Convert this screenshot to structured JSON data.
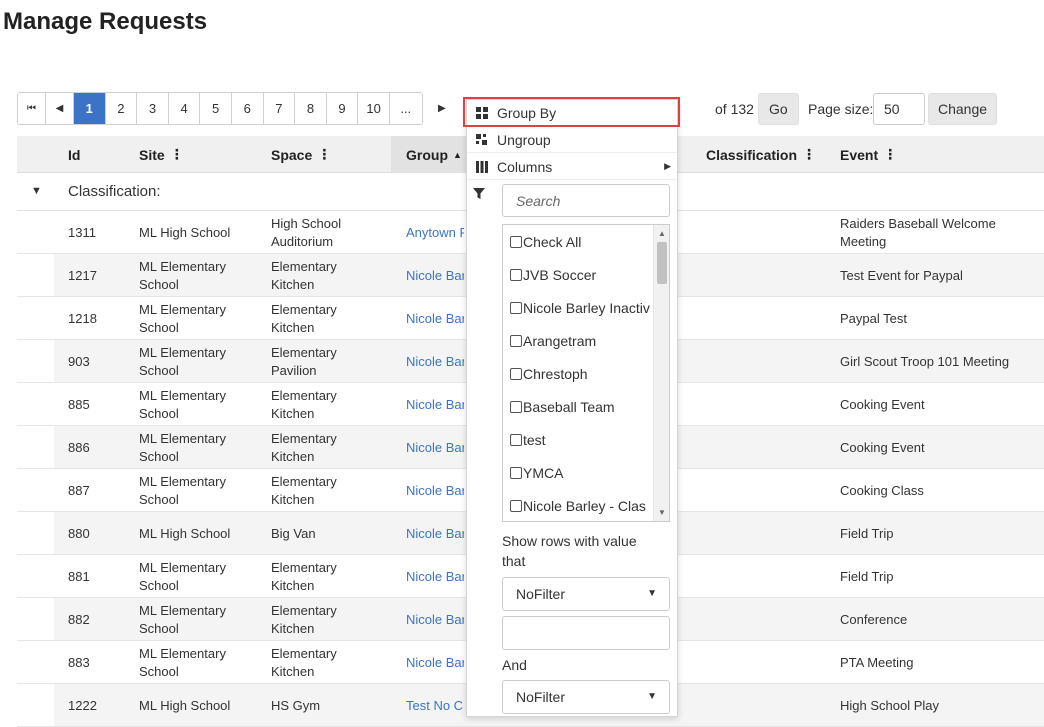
{
  "page": {
    "title": "Manage Requests"
  },
  "pager": {
    "first_icon": "first-page-icon",
    "prev_icon": "prev-page-icon",
    "next_icon": "next-page-icon",
    "pages": [
      "1",
      "2",
      "3",
      "4",
      "5",
      "6",
      "7",
      "8",
      "9",
      "10",
      "..."
    ],
    "active_page": "1",
    "current_page_partial": "1",
    "of_label": "of 132",
    "go_label": "Go",
    "page_size_label": "Page size:",
    "page_size_value": "50",
    "change_label": "Change"
  },
  "grid": {
    "columns": [
      "Id",
      "Site",
      "Space",
      "Group",
      "Classification",
      "Event"
    ],
    "group_label": "Classification:",
    "rows": [
      {
        "id": "1311",
        "site": "ML High School",
        "space": "High School Auditorium",
        "group": "Anytown F Baseball",
        "event": "Raiders Baseball Welcome Meeting"
      },
      {
        "id": "1217",
        "site": "ML Elementary School",
        "space": "Elementary Kitchen",
        "group": "Nicole Bar",
        "event": "Test Event for Paypal"
      },
      {
        "id": "1218",
        "site": "ML Elementary School",
        "space": "Elementary Kitchen",
        "group": "Nicole Bar",
        "event": "Paypal Test"
      },
      {
        "id": "903",
        "site": "ML Elementary School",
        "space": "Elementary Pavilion",
        "group": "Nicole Bar",
        "event": "Girl Scout Troop 101 Meeting"
      },
      {
        "id": "885",
        "site": "ML Elementary School",
        "space": "Elementary Kitchen",
        "group": "Nicole Bar",
        "event": "Cooking Event"
      },
      {
        "id": "886",
        "site": "ML Elementary School",
        "space": "Elementary Kitchen",
        "group": "Nicole Bar",
        "event": "Cooking Event"
      },
      {
        "id": "887",
        "site": "ML Elementary School",
        "space": "Elementary Kitchen",
        "group": "Nicole Bar",
        "event": "Cooking Class"
      },
      {
        "id": "880",
        "site": "ML High School",
        "space": "Big Van",
        "group": "Nicole Bar",
        "event": "Field Trip"
      },
      {
        "id": "881",
        "site": "ML Elementary School",
        "space": "Elementary Kitchen",
        "group": "Nicole Bar",
        "event": "Field Trip"
      },
      {
        "id": "882",
        "site": "ML Elementary School",
        "space": "Elementary Kitchen",
        "group": "Nicole Bar",
        "event": "Conference"
      },
      {
        "id": "883",
        "site": "ML Elementary School",
        "space": "Elementary Kitchen",
        "group": "Nicole Bar",
        "event": "PTA Meeting"
      },
      {
        "id": "1222",
        "site": "ML High School",
        "space": "HS Gym",
        "group": "Test No C",
        "event": "High School Play"
      }
    ]
  },
  "menu": {
    "group_by": "Group By",
    "ungroup": "Ungroup",
    "columns": "Columns",
    "search_placeholder": "Search",
    "filter_items": [
      "Check All",
      "JVB Soccer",
      "Nicole Barley Inactiv",
      "Arangetram",
      "Chrestoph",
      "Baseball Team",
      "test",
      "YMCA",
      "Nicole Barley - Clas"
    ],
    "show_rows_label": "Show rows with value that",
    "filter1_value": "NoFilter",
    "and_label": "And",
    "filter2_value": "NoFilter"
  },
  "colors": {
    "accent": "#3b74c6",
    "highlight": "#e04040"
  }
}
